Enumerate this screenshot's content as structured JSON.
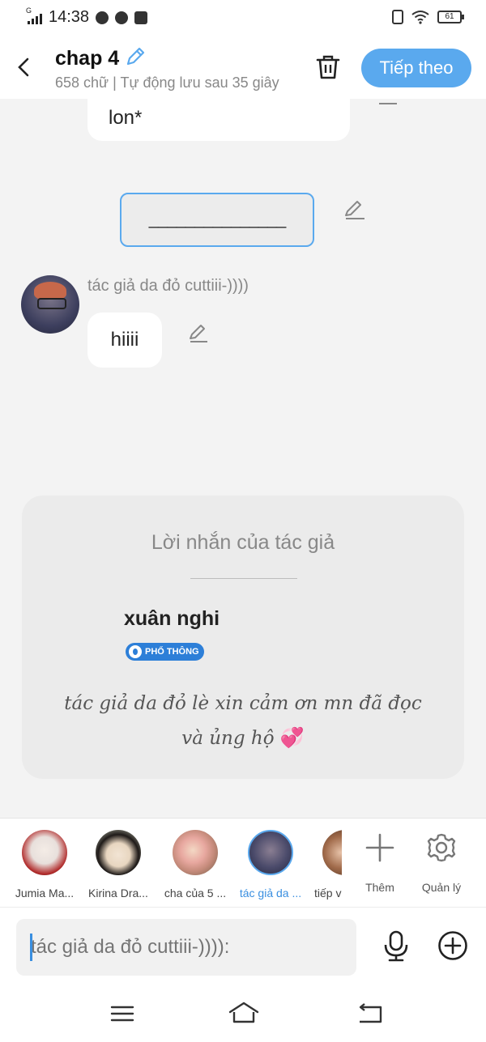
{
  "status_bar": {
    "time": "14:38",
    "network": "G",
    "battery": "61"
  },
  "header": {
    "title": "chap 4",
    "subtitle": "658 chữ | Tự động lưu sau 35 giây",
    "next_label": "Tiếp theo"
  },
  "chat": {
    "prev_bubble_text": "lon*",
    "divider_text": "_______________",
    "sender_name": "tác giả da đỏ cuttiii-))))",
    "message_text": "hiiii"
  },
  "author_note": {
    "title": "Lời nhắn của tác giả",
    "author": "xuân nghi",
    "badge": "PHỔ THÔNG",
    "message": "tác giả da đỏ lè xin cảm ơn mn đã đọc và ủng hộ",
    "emoji": "💞"
  },
  "characters": [
    {
      "label": "Jumia Ma..."
    },
    {
      "label": "Kirina Dra..."
    },
    {
      "label": "cha của 5 ..."
    },
    {
      "label": "tác giả da ..."
    },
    {
      "label": "tiếp v"
    }
  ],
  "tools": {
    "add_label": "Thêm",
    "manage_label": "Quản lý"
  },
  "input": {
    "placeholder": "tác giả da đỏ cuttiii-)))):"
  },
  "colors": {
    "accent": "#5aa9ee",
    "badge": "#2d7fd8",
    "heart": "#f08ab8"
  }
}
